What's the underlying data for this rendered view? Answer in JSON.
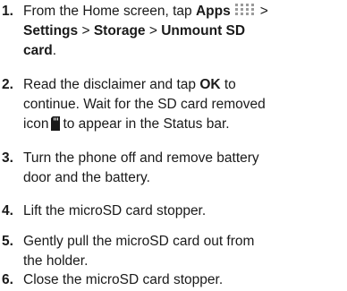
{
  "steps": [
    {
      "number": "1.",
      "line1_pre": "From the Home screen, tap ",
      "apps": "Apps",
      "gt": ">",
      "settings": "Settings",
      "sep1": " > ",
      "storage": "Storage",
      "sep2": " > ",
      "unmount": "Unmount SD",
      "card": "card",
      "period": ".",
      "apps_icon": "apps-grid-icon"
    },
    {
      "number": "2.",
      "line1_pre": "Read the disclaimer and tap ",
      "ok": "OK",
      "line1_post": " to",
      "line2": "continue. Wait for the SD card removed",
      "line3_pre": "icon",
      "line3_post": "to appear in the Status bar.",
      "sd_icon": "sd-card-removed-icon"
    },
    {
      "number": "3.",
      "line1": "Turn the phone off and remove battery",
      "line2": "door and the battery."
    },
    {
      "number": "4.",
      "line1": "Lift the microSD card stopper."
    },
    {
      "number": "5.",
      "line1": "Gently pull the microSD card out from",
      "line2": "the holder."
    },
    {
      "number": "6.",
      "line1": "Close the microSD card stopper."
    }
  ]
}
